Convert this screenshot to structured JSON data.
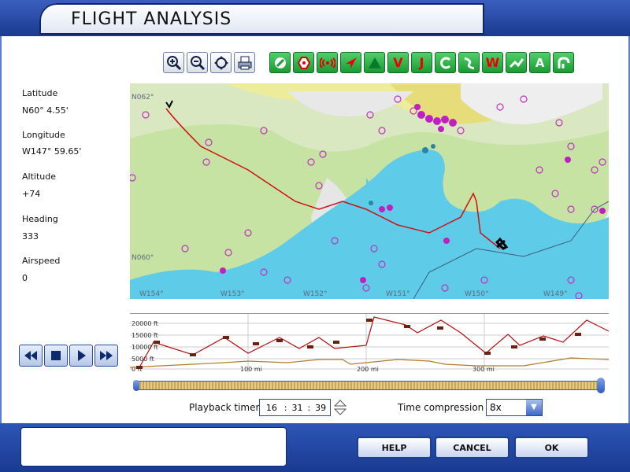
{
  "window": {
    "title": "FLIGHT ANALYSIS"
  },
  "toolbar": {
    "map_tools": [
      "zoom-in-icon",
      "zoom-out-icon",
      "pan-icon",
      "print-icon"
    ],
    "filters": [
      {
        "icon": "slash-check-icon"
      },
      {
        "icon": "hexagon-icon"
      },
      {
        "icon": "radio-signal-icon"
      },
      {
        "icon": "arrow-icon"
      },
      {
        "icon": "triangle-icon"
      },
      {
        "label": "V"
      },
      {
        "label": "J"
      },
      {
        "icon": "circular-route-icon"
      },
      {
        "icon": "curve-route-icon"
      },
      {
        "label": "W"
      },
      {
        "icon": "airway-icon"
      },
      {
        "label": "A"
      },
      {
        "icon": "approach-icon"
      }
    ]
  },
  "info": {
    "latitude_label": "Latitude",
    "latitude_value": "N60° 4.55'",
    "longitude_label": "Longitude",
    "longitude_value": "W147° 59.65'",
    "altitude_label": "Altitude",
    "altitude_value": "+74",
    "heading_label": "Heading",
    "heading_value": "333",
    "airspeed_label": "Airspeed",
    "airspeed_value": "0"
  },
  "map": {
    "labels": [
      "N062°",
      "N060°",
      "W154°",
      "W153°",
      "W152°",
      "W151°",
      "W150°",
      "W149°"
    ]
  },
  "profile": {
    "alt_labels": [
      "20000 ft",
      "15000 ft",
      "10000 ft",
      "5000 ft",
      "0 ft"
    ],
    "dist_labels": [
      "100 mi",
      "200 mi",
      "300 mi"
    ]
  },
  "playback": {
    "timer_label": "Playback timer",
    "hours": "16",
    "minutes": "31",
    "seconds": "39",
    "sep": ":",
    "compression_label": "Time compression",
    "compression_value": "8x"
  },
  "buttons": {
    "help": "HELP",
    "cancel": "CANCEL",
    "ok": "OK"
  }
}
